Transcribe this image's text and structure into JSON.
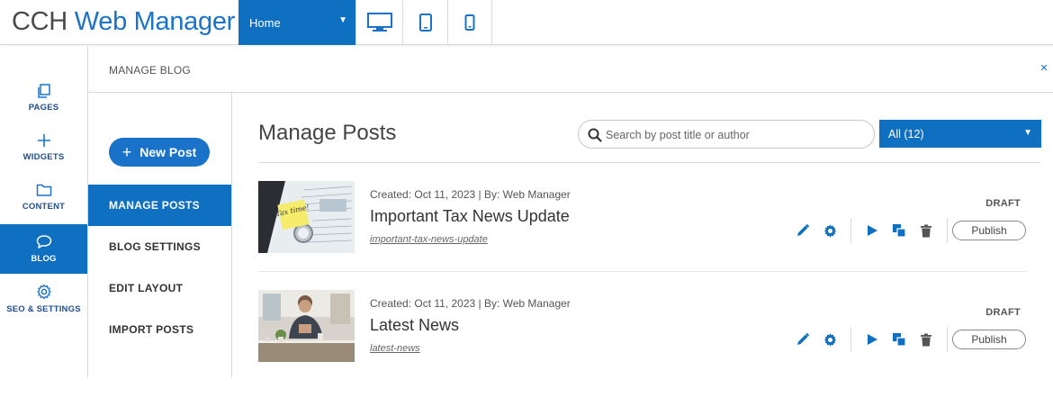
{
  "header": {
    "logo_part1": "CCH",
    "logo_part2": "Web Manager",
    "page_selector": "Home",
    "devices": [
      "desktop-icon",
      "tablet-icon",
      "mobile-icon"
    ]
  },
  "leftnav": {
    "items": [
      {
        "label": "PAGES",
        "icon": "pages-icon"
      },
      {
        "label": "WIDGETS",
        "icon": "plus-icon"
      },
      {
        "label": "CONTENT",
        "icon": "folder-icon"
      },
      {
        "label": "BLOG",
        "icon": "chat-bubble-icon",
        "active": true
      },
      {
        "label": "SEO & SETTINGS",
        "icon": "gear-icon"
      }
    ]
  },
  "panel": {
    "title": "MANAGE BLOG",
    "close": "×"
  },
  "blognav": {
    "new_post": "New Post",
    "items": [
      "MANAGE POSTS",
      "BLOG SETTINGS",
      "EDIT LAYOUT",
      "IMPORT POSTS"
    ]
  },
  "main": {
    "title": "Manage Posts",
    "search_placeholder": "Search by post title or author",
    "filter_label": "All (12)"
  },
  "posts": [
    {
      "meta": "Created: Oct 11, 2023 | By: Web Manager",
      "title": "Important Tax News Update",
      "slug": "important-tax-news-update",
      "status": "DRAFT",
      "publish": "Publish",
      "thumb_note": "Tax time!"
    },
    {
      "meta": "Created: Oct 11, 2023 | By: Web Manager",
      "title": "Latest News",
      "slug": "latest-news",
      "status": "DRAFT",
      "publish": "Publish"
    }
  ],
  "colors": {
    "brand_blue": "#0f6fc0",
    "logo_blue": "#1a73c8",
    "text_dark": "#333333"
  }
}
